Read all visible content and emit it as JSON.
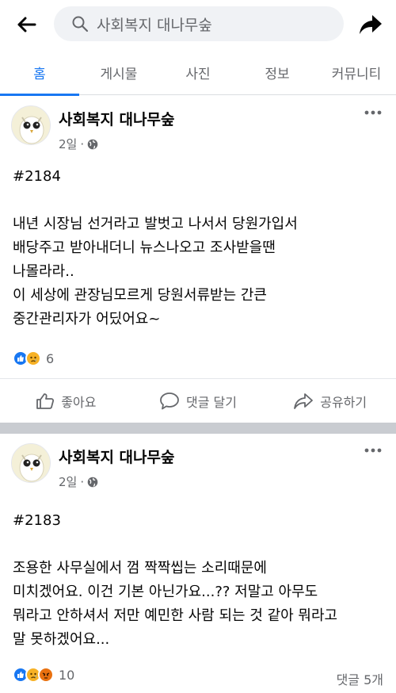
{
  "header": {
    "search_text": "사회복지 대나무숲"
  },
  "tabs": [
    {
      "label": "홈"
    },
    {
      "label": "게시물"
    },
    {
      "label": "사진"
    },
    {
      "label": "정보"
    },
    {
      "label": "커뮤니티"
    }
  ],
  "posts": [
    {
      "page_name": "사회복지 대나무숲",
      "time": "2일",
      "dot": "·",
      "text": "#2184\n\n내년 시장님 선거라고 발벗고 나서서 당원가입서\n배당주고 받아내더니 뉴스나오고 조사받을땐\n나몰라라..\n이 세상에 관장님모르게 당원서류받는 간큰\n중간관리자가 어딨어요~",
      "reaction_count": "6",
      "actions": {
        "like": "좋아요",
        "comment": "댓글 달기",
        "share": "공유하기"
      }
    },
    {
      "page_name": "사회복지 대나무숲",
      "time": "2일",
      "dot": "·",
      "text": "#2183\n\n조용한 사무실에서 껌 짝짝씹는 소리때문에\n미치겠어요. 이건 기본 아닌가요...?? 저말고 아무도\n뭐라고 안하셔서 저만 예민한 사람 되는 것 같아 뭐라고\n말 못하겠어요...",
      "reaction_count": "10",
      "comments_count": "댓글 5개"
    }
  ],
  "colors": {
    "accent": "#1877f2",
    "secondary_text": "#65676b",
    "separator": "#c9ccd1"
  }
}
